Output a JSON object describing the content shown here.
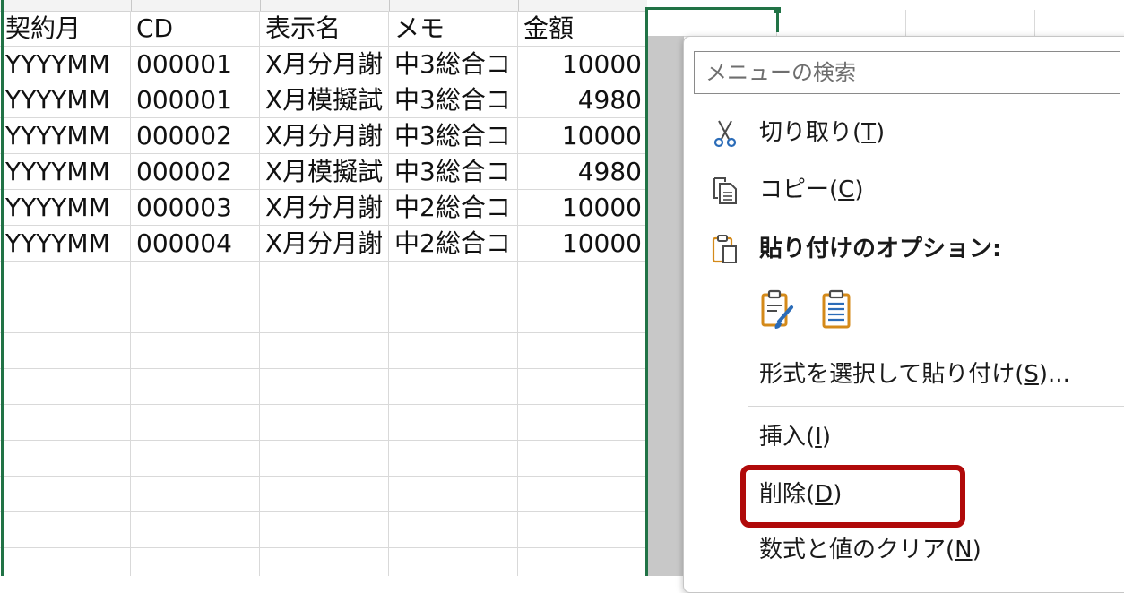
{
  "sheet": {
    "columns": [
      "契約月",
      "CD",
      "表示名",
      "メモ",
      "金額"
    ],
    "rows": [
      [
        "YYYYMM",
        "000001",
        "X月分月謝",
        "中3総合コ",
        "10000"
      ],
      [
        "YYYYMM",
        "000001",
        "X月模擬試",
        "中3総合コ",
        "4980"
      ],
      [
        "YYYYMM",
        "000002",
        "X月分月謝",
        "中3総合コ",
        "10000"
      ],
      [
        "YYYYMM",
        "000002",
        "X月模擬試",
        "中3総合コ",
        "4980"
      ],
      [
        "YYYYMM",
        "000003",
        "X月分月謝",
        "中2総合コ",
        "10000"
      ],
      [
        "YYYYMM",
        "000004",
        "X月分月謝",
        "中2総合コ",
        "10000"
      ]
    ],
    "selection_color": "#217346"
  },
  "context_menu": {
    "search_placeholder": "メニューの検索",
    "cut": {
      "text": "切り取り(",
      "key": "T",
      "end": ")",
      "icon": "scissors-icon"
    },
    "copy": {
      "text": "コピー(",
      "key": "C",
      "end": ")",
      "icon": "copy-icon"
    },
    "paste_options": {
      "label": "貼り付けのオプション:",
      "icon": "clipboard-icon",
      "buttons": [
        "paste-formatting-icon",
        "paste-values-icon"
      ]
    },
    "paste_special": {
      "text": "形式を選択して貼り付け(",
      "key": "S",
      "end": ")..."
    },
    "insert": {
      "text": "挿入(",
      "key": "I",
      "end": ")"
    },
    "delete": {
      "text": "削除(",
      "key": "D",
      "end": ")"
    },
    "clear": {
      "text": "数式と値のクリア(",
      "key": "N",
      "end": ")"
    },
    "highlight_color": "#b00a0a",
    "accent_color": "#d48a1a"
  }
}
